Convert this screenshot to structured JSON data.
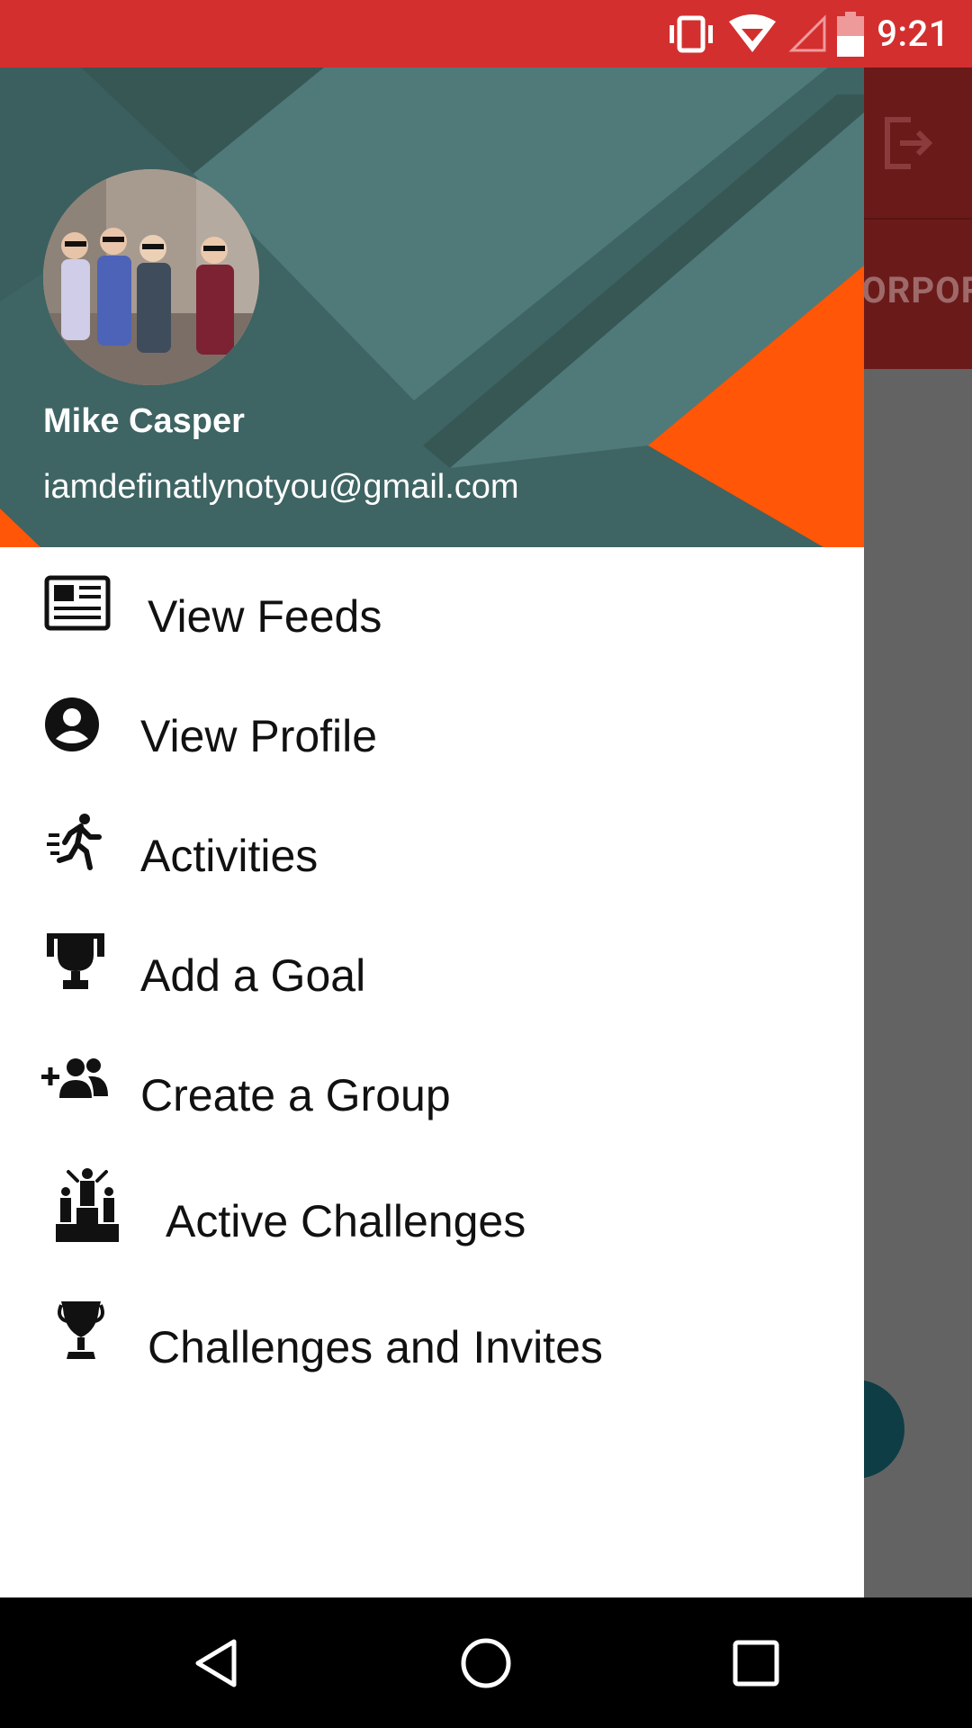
{
  "status_bar": {
    "time": "9:21",
    "icons": [
      "vibrate-icon",
      "wifi-icon",
      "cell-signal-icon",
      "battery-icon"
    ],
    "background": "#d32f2f"
  },
  "app_behind": {
    "tab_label": "CORPORATE",
    "icons": [
      "logout-icon"
    ]
  },
  "drawer": {
    "header": {
      "name": "Mike Casper",
      "email": "iamdefinatlynotyou@gmail.com",
      "colors": {
        "teal_dark": "#3e6463",
        "teal_light": "#4f7a79",
        "orange": "#ff5607"
      }
    },
    "menu": [
      {
        "label": "View Feeds",
        "icon": "newspaper-icon"
      },
      {
        "label": "View Profile",
        "icon": "account-circle-icon"
      },
      {
        "label": "Activities",
        "icon": "running-person-icon"
      },
      {
        "label": "Add a Goal",
        "icon": "trophy-icon"
      },
      {
        "label": "Create a Group",
        "icon": "add-group-icon"
      },
      {
        "label": "Active Challenges",
        "icon": "podium-icon"
      },
      {
        "label": "Challenges and Invites",
        "icon": "cup-icon"
      }
    ]
  },
  "nav_bar": {
    "buttons": [
      "back-icon",
      "home-icon",
      "recents-icon"
    ]
  }
}
